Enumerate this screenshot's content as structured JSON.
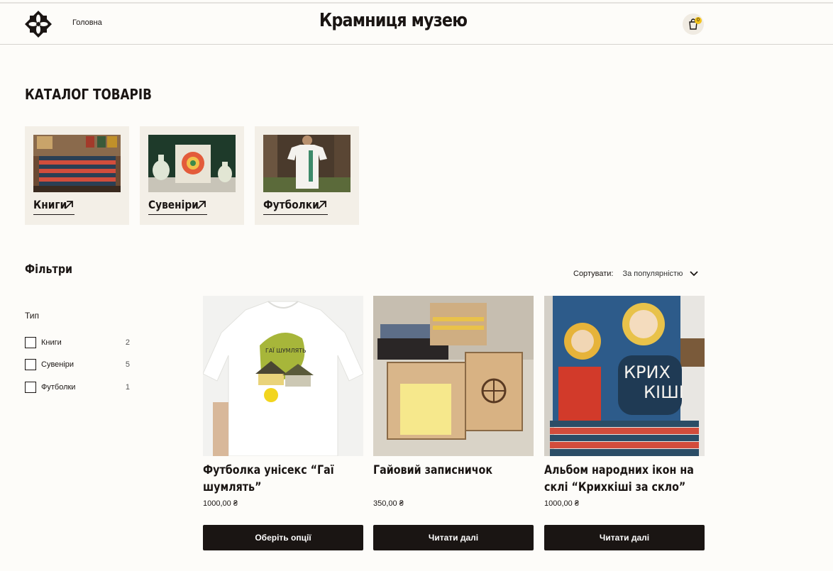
{
  "header": {
    "nav_home": "Головна",
    "site_title": "Крамниця музею",
    "cart_count": "0"
  },
  "catalog": {
    "title": "КАТАЛОГ ТОВАРІВ",
    "categories": [
      {
        "label": "Книги"
      },
      {
        "label": "Сувеніри"
      },
      {
        "label": "Футболки"
      }
    ]
  },
  "filters": {
    "title": "Фільтри",
    "group_title": "Тип",
    "items": [
      {
        "label": "Книги",
        "count": "2"
      },
      {
        "label": "Сувеніри",
        "count": "5"
      },
      {
        "label": "Футболки",
        "count": "1"
      }
    ]
  },
  "sort": {
    "label": "Сортувати:",
    "value": "За популярністю"
  },
  "products": [
    {
      "name": "Футболка унісекс “Гаї шумлять”",
      "price": "1000,00 ₴",
      "button": "Оберіть опції"
    },
    {
      "name": "Гайовий записничок",
      "price": "350,00 ₴",
      "button": "Читати далі"
    },
    {
      "name": "Альбом народних ікон на склі “Крихкіші за скло”",
      "price": "1000,00 ₴",
      "button": "Читати далі"
    }
  ],
  "colors": {
    "dark": "#1a1513",
    "card_bg": "#f3efe7",
    "badge": "#f2c21b"
  }
}
